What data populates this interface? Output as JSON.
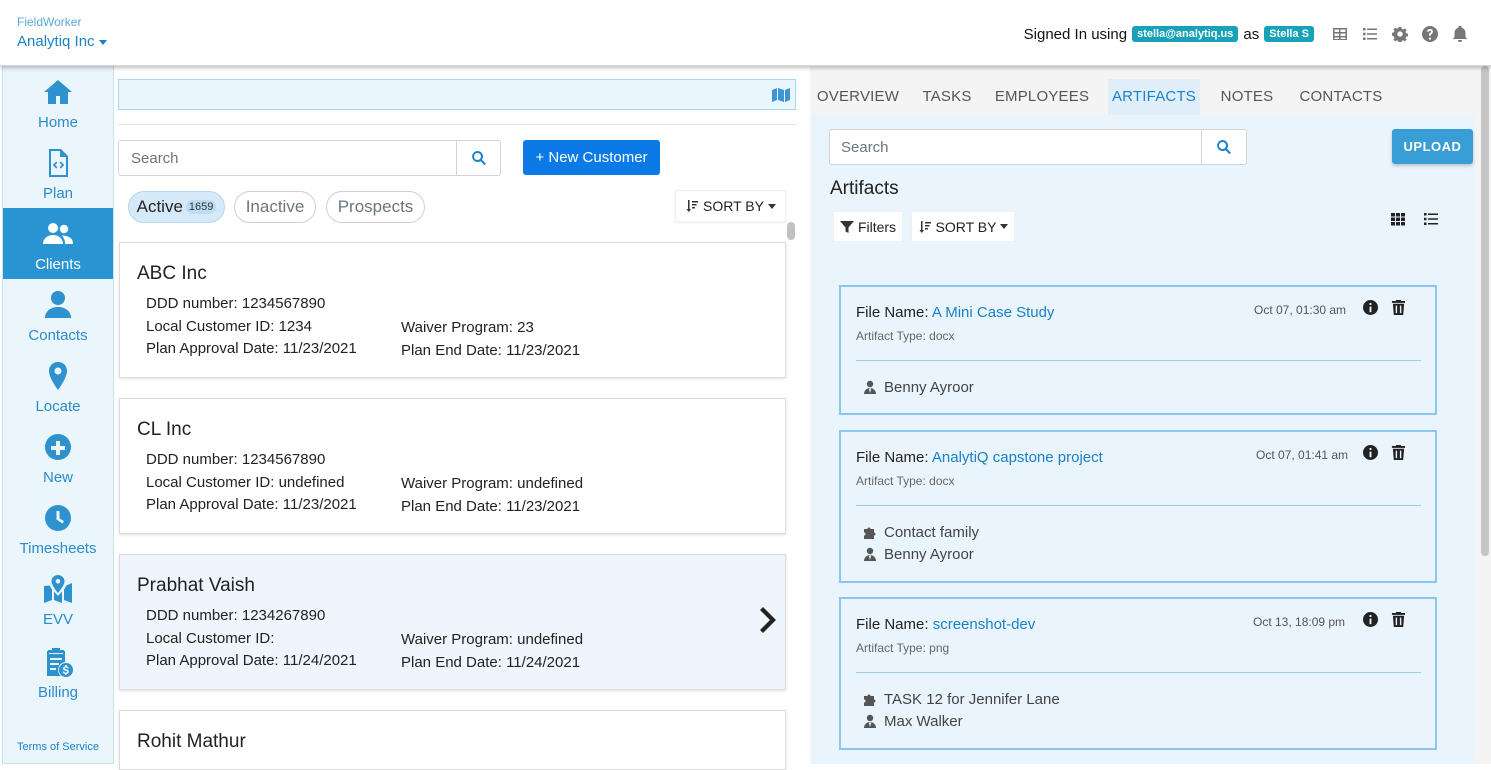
{
  "header": {
    "app_name": "FieldWorker",
    "org_name": "Analytiq Inc",
    "signin_prefix": "Signed In using",
    "email_badge": "stella@analytiq.us",
    "as_label": "as",
    "user_badge": "Stella S",
    "icons": [
      "table-icon",
      "list-icon",
      "gear-icon",
      "help-icon",
      "bell-icon"
    ]
  },
  "sidebar": {
    "items": [
      {
        "label": "Home",
        "icon": "home-icon"
      },
      {
        "label": "Plan",
        "icon": "file-code-icon"
      },
      {
        "label": "Clients",
        "icon": "users-icon",
        "active": true
      },
      {
        "label": "Contacts",
        "icon": "user-icon"
      },
      {
        "label": "Locate",
        "icon": "map-marker-icon"
      },
      {
        "label": "New",
        "icon": "plus-circle-icon"
      },
      {
        "label": "Timesheets",
        "icon": "clock-icon"
      },
      {
        "label": "EVV",
        "icon": "map-location-icon"
      },
      {
        "label": "Billing",
        "icon": "invoice-dollar-icon"
      }
    ],
    "terms": "Terms of Service"
  },
  "customers": {
    "search_placeholder": "Search",
    "new_button": "+ New Customer",
    "filters": {
      "active": "Active",
      "active_count": "1659",
      "inactive": "Inactive",
      "prospects": "Prospects"
    },
    "sort_label": "SORT BY",
    "labels": {
      "ddd": "DDD number:",
      "local_id": "Local Customer ID:",
      "plan_approval": "Plan Approval Date:",
      "waiver": "Waiver Program:",
      "plan_end": "Plan End Date:"
    },
    "list": [
      {
        "name": "ABC Inc",
        "ddd": "1234567890",
        "local_id": "1234",
        "plan_approval": "11/23/2021",
        "waiver": "23",
        "plan_end": "11/23/2021"
      },
      {
        "name": "CL Inc",
        "ddd": "1234567890",
        "local_id": "undefined",
        "plan_approval": "11/23/2021",
        "waiver": "undefined",
        "plan_end": "11/23/2021"
      },
      {
        "name": "Prabhat Vaish",
        "ddd": "1234267890",
        "local_id": "",
        "plan_approval": "11/24/2021",
        "waiver": "undefined",
        "plan_end": "11/24/2021"
      },
      {
        "name": "Rohit Mathur"
      }
    ]
  },
  "detail": {
    "tabs": [
      "OVERVIEW",
      "TASKS",
      "EMPLOYEES",
      "ARTIFACTS",
      "NOTES",
      "CONTACTS"
    ],
    "active_tab": "ARTIFACTS",
    "search_placeholder": "Search",
    "upload_label": "UPLOAD",
    "heading": "Artifacts",
    "filters_label": "Filters",
    "sort_label": "SORT BY",
    "file_name_label": "File Name:",
    "type_label": "Artifact Type:",
    "artifacts": [
      {
        "file": "A Mini Case Study",
        "type": "docx",
        "date": "Oct 07, 01:30 am",
        "refs": [
          {
            "icon": "user-tie-icon",
            "text": "Benny Ayroor"
          }
        ]
      },
      {
        "file": "AnalytiQ capstone project",
        "type": "docx",
        "date": "Oct 07, 01:41 am",
        "refs": [
          {
            "icon": "puzzle-icon",
            "text": "Contact family"
          },
          {
            "icon": "user-tie-icon",
            "text": "Benny Ayroor"
          }
        ]
      },
      {
        "file": "screenshot-dev",
        "type": "png",
        "date": "Oct 13, 18:09 pm",
        "refs": [
          {
            "icon": "puzzle-icon",
            "text": "TASK 12 for Jennifer Lane"
          },
          {
            "icon": "user-tie-icon",
            "text": "Max Walker"
          }
        ]
      }
    ]
  }
}
